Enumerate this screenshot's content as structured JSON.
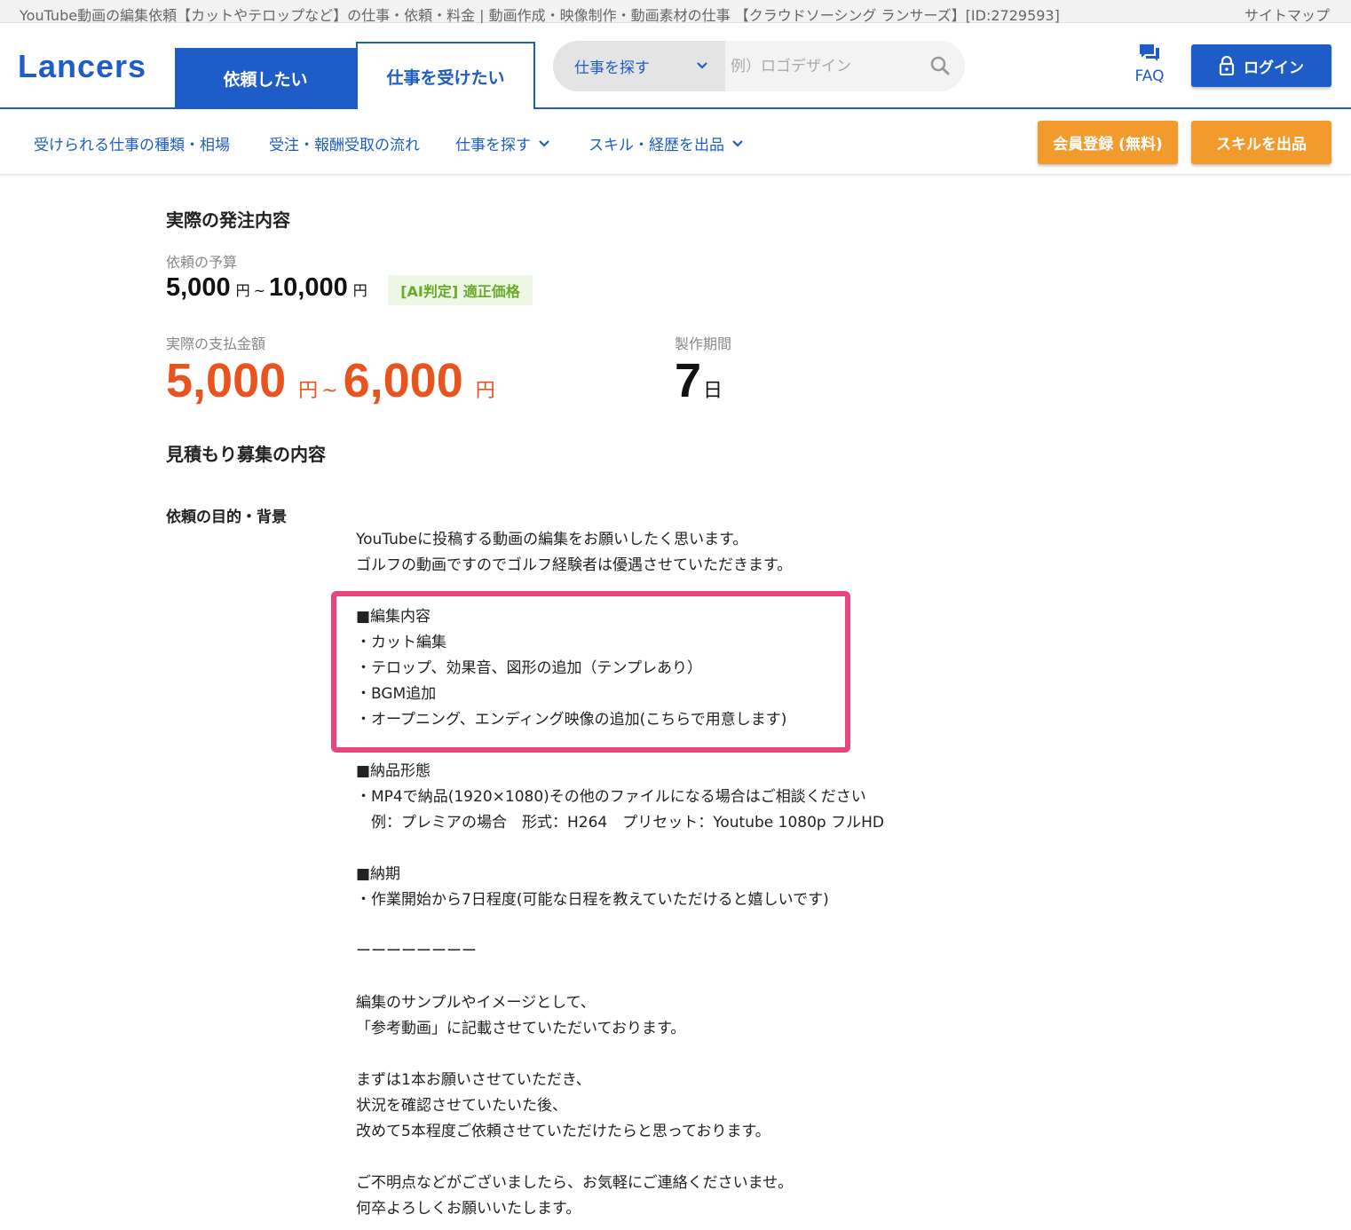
{
  "window": {
    "title": "YouTube動画の編集依頼【カットやテロップなど】の仕事・依頼・料金 | 動画作成・映像制作・動画素材の仕事 【クラウドソーシング ランサーズ】[ID:2729593]",
    "sitemap_label": "サイトマップ"
  },
  "header": {
    "logo": "Lancers",
    "tab_client": "依頼したい",
    "tab_worker": "仕事を受けたい",
    "search_category": "仕事を探す",
    "search_placeholder": "例）ロゴデザイン",
    "faq_label": "FAQ",
    "login_label": "ログイン"
  },
  "subnav": {
    "items": [
      "受けられる仕事の種類・相場",
      "受注・報酬受取の流れ",
      "仕事を探す",
      "スキル・経歴を出品"
    ],
    "register_button": "会員登録 (無料)",
    "sell_skill_button": "スキルを出品"
  },
  "order": {
    "heading": "実際の発注内容",
    "budget_label": "依頼の予算",
    "budget_min": "5,000",
    "budget_max": "10,000",
    "yen": "円",
    "tilde": "~",
    "ai_badge": "[AI判定] 適正価格",
    "payment_label": "実際の支払金額",
    "payment_min": "5,000",
    "payment_max": "6,000",
    "period_label": "製作期間",
    "period_value": "7",
    "period_unit": "日"
  },
  "estimate": {
    "heading": "見積もり募集の内容",
    "purpose_label": "依頼の目的・背景",
    "lines_intro": [
      "YouTubeに投稿する動画の編集をお願いしたく思います。",
      "ゴルフの動画ですのでゴルフ経験者は優遇させていただきます。"
    ],
    "lines_edit": [
      "■編集内容",
      "・カット編集",
      "・テロップ、効果音、図形の追加（テンプレあり）",
      "・BGM追加",
      "・オープニング、エンディング映像の追加(こちらで用意します)"
    ],
    "lines_delivery": [
      "■納品形態",
      "・MP4で納品(1920×1080)その他のファイルになる場合はご相談ください",
      "　例：プレミアの場合　形式：H264　プリセット：Youtube 1080p フルHD"
    ],
    "lines_deadline": [
      "■納期",
      "・作業開始から7日程度(可能な日程を教えていただけると嬉しいです)"
    ],
    "divider": "ーーーーーーーー",
    "lines_sample": [
      "編集のサンプルやイメージとして、",
      "「参考動画」に記載させていただいております。"
    ],
    "lines_plan": [
      "まずは1本お願いさせていただき、",
      "状況を確認させていたいた後、",
      "改めて5本程度ご依頼させていただけたらと思っております。"
    ],
    "lines_closing": [
      "ご不明点などがございましたら、お気軽にご連絡くださいませ。",
      "何卒よろしくお願いいたします。"
    ]
  },
  "colors": {
    "brand_blue": "#1e5cc8",
    "orange": "#f39a2d",
    "price_red": "#e8531e",
    "highlight_pink": "#e8457a",
    "ai_green": "#6aaa2a"
  }
}
